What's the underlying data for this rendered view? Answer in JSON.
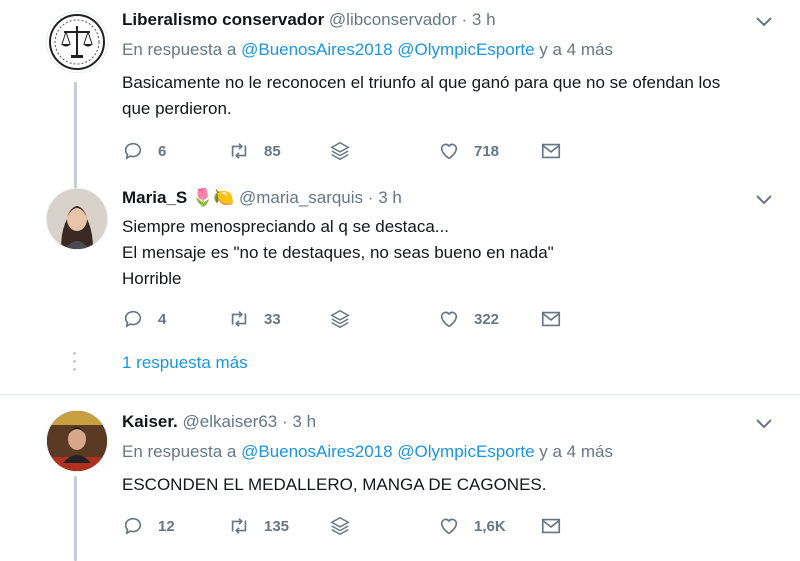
{
  "colors": {
    "link": "#1b95e0",
    "muted": "#657786",
    "text": "#14171a",
    "divider": "#e6ecf0"
  },
  "tweets": [
    {
      "name": "Liberalismo conservador",
      "handle": "@libconservador",
      "time": "3 h",
      "reply_prefix": "En respuesta a",
      "reply_mentions": [
        "@BuenosAires2018",
        "@OlympicEsporte"
      ],
      "reply_suffix": "y a 4 más",
      "text_lines": [
        "Basicamente no le reconocen el triunfo al que ganó para que no se ofendan los",
        "que perdieron."
      ],
      "replies": "6",
      "retweets": "85",
      "likes": "718"
    },
    {
      "name": "Maria_S",
      "name_emoji": "🌷🍋",
      "handle": "@maria_sarquis",
      "time": "3 h",
      "text_lines": [
        "Siempre menospreciando al q se destaca...",
        "El mensaje es \"no te destaques, no seas bueno en nada\"",
        "Horrible"
      ],
      "replies": "4",
      "retweets": "33",
      "likes": "322"
    },
    {
      "name": "Kaiser.",
      "handle": "@elkaiser63",
      "time": "3 h",
      "reply_prefix": "En respuesta a",
      "reply_mentions": [
        "@BuenosAires2018",
        "@OlympicEsporte"
      ],
      "reply_suffix": "y a 4 más",
      "text_lines": [
        "ESCONDEN EL MEDALLERO, MANGA DE CAGONES."
      ],
      "replies": "12",
      "retweets": "135",
      "likes": "1,6K"
    }
  ],
  "more_replies": "1 respuesta más",
  "separator": "·",
  "icons": [
    "scales-logo-icon",
    "reply-icon",
    "retweet-icon",
    "stack-icon",
    "heart-icon",
    "message-icon",
    "chevron-down-icon"
  ]
}
